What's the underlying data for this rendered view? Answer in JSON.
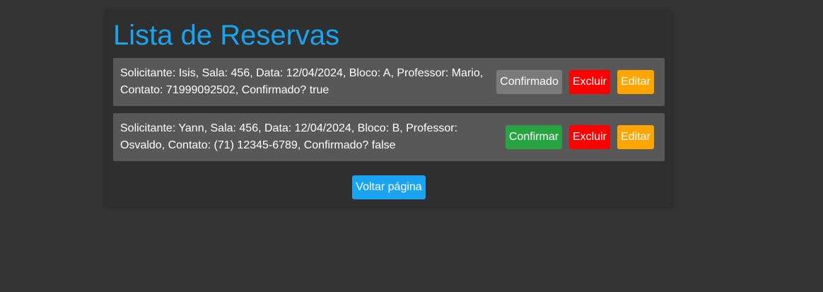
{
  "page": {
    "title": "Lista de Reservas"
  },
  "reservations": [
    {
      "text": "Solicitante: Isis, Sala: 456, Data: 12/04/2024, Bloco: A, Professor: Mario, Contato: 71999092502, Confirmado? true",
      "status_label": "Confirmado",
      "delete_label": "Excluir",
      "edit_label": "Editar"
    },
    {
      "text": "Solicitante: Yann, Sala: 456, Data: 12/04/2024, Bloco: B, Professor: Osvaldo, Contato: (71) 12345-6789, Confirmado? false",
      "status_label": "Confirmar",
      "delete_label": "Excluir",
      "edit_label": "Editar"
    }
  ],
  "footer": {
    "back_label": "Voltar página"
  },
  "colors": {
    "background": "#333333",
    "accent": "#1aa3f0",
    "card": "#585858",
    "confirmed": "#7a7a7a",
    "confirm": "#27a341",
    "delete": "#ff0000",
    "edit": "#ffa500"
  }
}
